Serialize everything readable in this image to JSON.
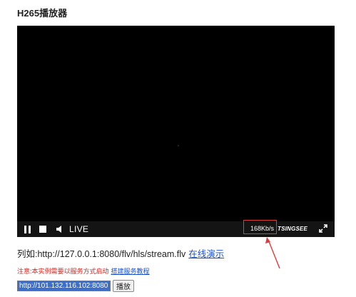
{
  "page": {
    "title": "H265播放器"
  },
  "player": {
    "live_label": "LIVE",
    "bitrate": "168Kb/s",
    "brand": "TSINGSEE",
    "controls": {
      "pause": "pause-icon",
      "stop": "stop-icon",
      "volume": "volume-icon",
      "fullscreen": "fullscreen-icon"
    },
    "annotation_color": "#e03a3a"
  },
  "example": {
    "prefix": "列如:",
    "url": "http://127.0.0.1:8080/flv/hls/stream.flv",
    "demo_link": "在线演示"
  },
  "note": {
    "text": "注意:本实例需要以服务方式启动",
    "link": "搭建服务教程"
  },
  "form": {
    "url_value": "http://101.132.116.102:8080",
    "play_button": "播放"
  },
  "colors": {
    "note_red": "#e0201a",
    "link_blue": "#1a4fd0",
    "player_bg": "#000000"
  }
}
